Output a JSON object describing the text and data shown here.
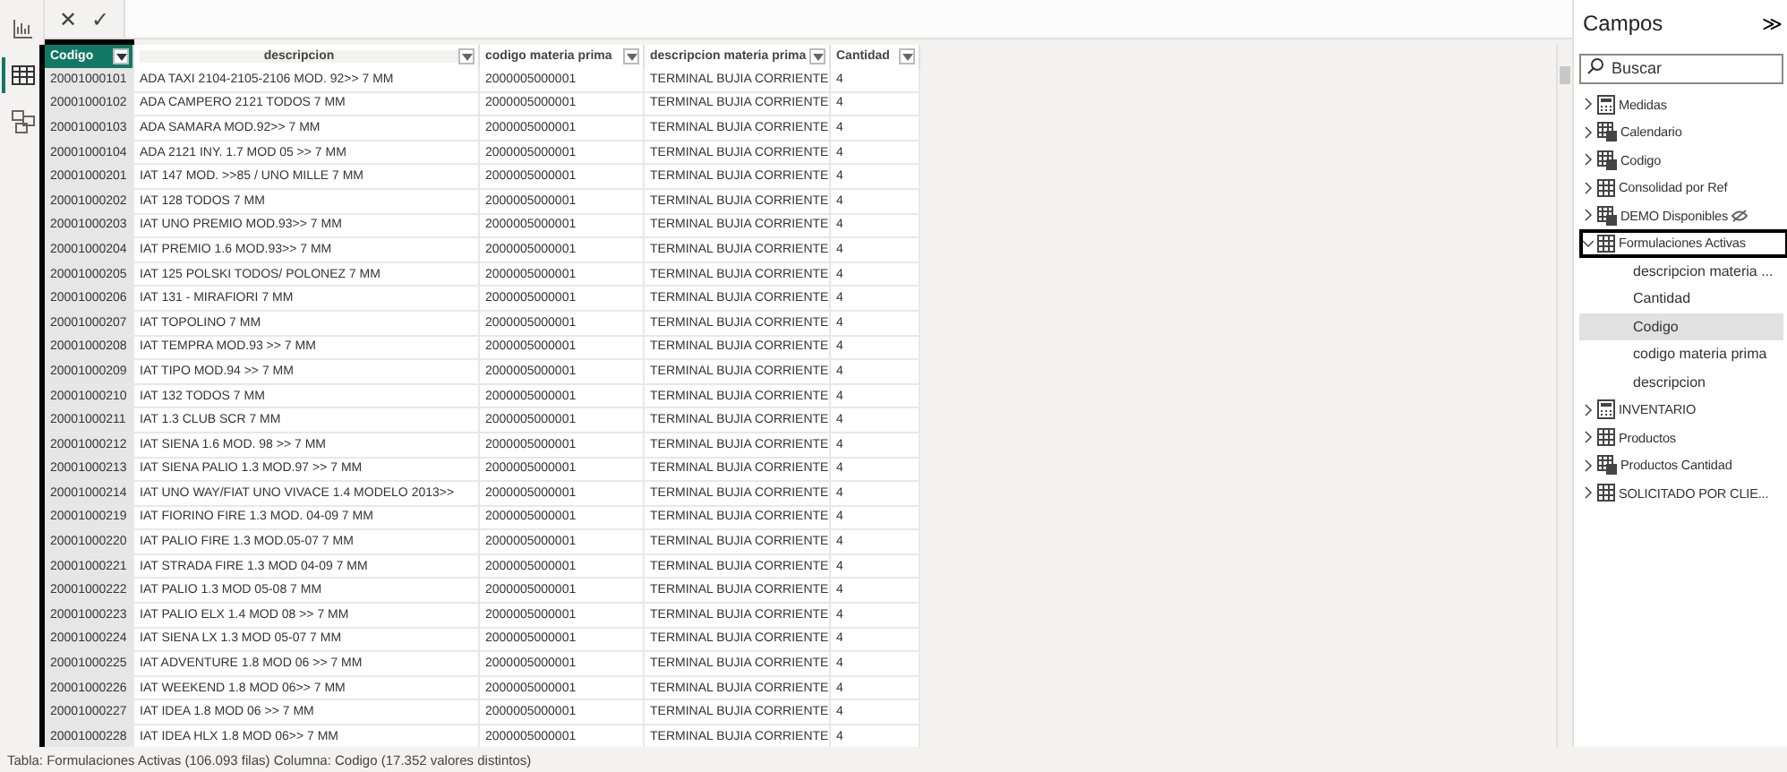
{
  "view_rail": [
    {
      "kind": "report",
      "selected": false
    },
    {
      "kind": "data",
      "selected": true
    },
    {
      "kind": "model",
      "selected": false
    }
  ],
  "formula_bar": {
    "cancel": "✕",
    "commit": "✓"
  },
  "table": {
    "columns": [
      {
        "label": "Codigo",
        "selected": true,
        "highlighted": true
      },
      {
        "label": "descripcion",
        "selected": false,
        "highlighted": false
      },
      {
        "label": "codigo materia prima",
        "selected": false,
        "highlighted": false
      },
      {
        "label": "descripcion materia prima",
        "selected": false,
        "highlighted": false
      },
      {
        "label": "Cantidad",
        "selected": false,
        "highlighted": false
      }
    ],
    "rows": [
      [
        "20001000101",
        "ADA TAXI  2104-2105-2106 MOD. 92>> 7 MM",
        "2000005000001",
        "TERMINAL BUJIA CORRIENTE",
        "4"
      ],
      [
        "20001000102",
        "ADA CAMPERO 2121 TODOS 7 MM",
        "2000005000001",
        "TERMINAL BUJIA CORRIENTE",
        "4"
      ],
      [
        "20001000103",
        "ADA SAMARA MOD.92>> 7 MM",
        "2000005000001",
        "TERMINAL BUJIA CORRIENTE",
        "4"
      ],
      [
        "20001000104",
        "ADA 2121 INY. 1.7 MOD 05 >> 7 MM",
        "2000005000001",
        "TERMINAL BUJIA CORRIENTE",
        "4"
      ],
      [
        "20001000201",
        "IAT 147 MOD. >>85 / UNO MILLE 7 MM",
        "2000005000001",
        "TERMINAL BUJIA CORRIENTE",
        "4"
      ],
      [
        "20001000202",
        "IAT 128 TODOS 7 MM",
        "2000005000001",
        "TERMINAL BUJIA CORRIENTE",
        "4"
      ],
      [
        "20001000203",
        "IAT UNO PREMIO MOD.93>> 7 MM",
        "2000005000001",
        "TERMINAL BUJIA CORRIENTE",
        "4"
      ],
      [
        "20001000204",
        "IAT PREMIO 1.6 MOD.93>> 7 MM",
        "2000005000001",
        "TERMINAL BUJIA CORRIENTE",
        "4"
      ],
      [
        "20001000205",
        "IAT 125 POLSKI TODOS/ POLONEZ 7 MM",
        "2000005000001",
        "TERMINAL BUJIA CORRIENTE",
        "4"
      ],
      [
        "20001000206",
        "IAT 131 - MIRAFIORI 7 MM",
        "2000005000001",
        "TERMINAL BUJIA CORRIENTE",
        "4"
      ],
      [
        "20001000207",
        "IAT TOPOLINO 7 MM",
        "2000005000001",
        "TERMINAL BUJIA CORRIENTE",
        "4"
      ],
      [
        "20001000208",
        "IAT TEMPRA MOD.93 >> 7 MM",
        "2000005000001",
        "TERMINAL BUJIA CORRIENTE",
        "4"
      ],
      [
        "20001000209",
        "IAT TIPO MOD.94 >> 7 MM",
        "2000005000001",
        "TERMINAL BUJIA CORRIENTE",
        "4"
      ],
      [
        "20001000210",
        "IAT 132 TODOS 7 MM",
        "2000005000001",
        "TERMINAL BUJIA CORRIENTE",
        "4"
      ],
      [
        "20001000211",
        "IAT 1.3 CLUB SCR 7 MM",
        "2000005000001",
        "TERMINAL BUJIA CORRIENTE",
        "4"
      ],
      [
        "20001000212",
        "IAT SIENA 1.6 MOD. 98 >> 7 MM",
        "2000005000001",
        "TERMINAL BUJIA CORRIENTE",
        "4"
      ],
      [
        "20001000213",
        "IAT SIENA PALIO 1.3 MOD.97 >> 7 MM",
        "2000005000001",
        "TERMINAL BUJIA CORRIENTE",
        "4"
      ],
      [
        "20001000214",
        "IAT UNO WAY/FIAT UNO VIVACE 1.4 MODELO 2013>>",
        "2000005000001",
        "TERMINAL BUJIA CORRIENTE",
        "4"
      ],
      [
        "20001000219",
        "IAT FIORINO FIRE 1.3 MOD. 04-09 7 MM",
        "2000005000001",
        "TERMINAL BUJIA CORRIENTE",
        "4"
      ],
      [
        "20001000220",
        "IAT PALIO FIRE 1.3 MOD.05-07 7 MM",
        "2000005000001",
        "TERMINAL BUJIA CORRIENTE",
        "4"
      ],
      [
        "20001000221",
        "IAT STRADA FIRE 1.3 MOD 04-09 7 MM",
        "2000005000001",
        "TERMINAL BUJIA CORRIENTE",
        "4"
      ],
      [
        "20001000222",
        "IAT PALIO 1.3 MOD 05-08 7 MM",
        "2000005000001",
        "TERMINAL BUJIA CORRIENTE",
        "4"
      ],
      [
        "20001000223",
        "IAT PALIO ELX 1.4 MOD 08 >> 7 MM",
        "2000005000001",
        "TERMINAL BUJIA CORRIENTE",
        "4"
      ],
      [
        "20001000224",
        "IAT SIENA LX 1.3 MOD 05-07 7 MM",
        "2000005000001",
        "TERMINAL BUJIA CORRIENTE",
        "4"
      ],
      [
        "20001000225",
        "IAT ADVENTURE 1.8 MOD 06 >> 7 MM",
        "2000005000001",
        "TERMINAL BUJIA CORRIENTE",
        "4"
      ],
      [
        "20001000226",
        "IAT WEEKEND 1.8 MOD 06>> 7 MM",
        "2000005000001",
        "TERMINAL BUJIA CORRIENTE",
        "4"
      ],
      [
        "20001000227",
        "IAT IDEA 1.8 MOD 06 >> 7 MM",
        "2000005000001",
        "TERMINAL BUJIA CORRIENTE",
        "4"
      ],
      [
        "20001000228",
        "IAT IDEA HLX 1.8 MOD 06>> 7 MM",
        "2000005000001",
        "TERMINAL BUJIA CORRIENTE",
        "4"
      ]
    ]
  },
  "status_bar": "Tabla: Formulaciones Activas (106.093 filas) Columna: Codigo (17.352 valores distintos)",
  "fields_pane": {
    "title": "Campos",
    "collapse": "≫",
    "search": {
      "placeholder": "Buscar"
    },
    "tables": [
      {
        "name": "Medidas",
        "kind": "measures",
        "expanded": false,
        "hidden": false,
        "highlighted": false
      },
      {
        "name": "Calendario",
        "kind": "calculated",
        "expanded": false,
        "hidden": false,
        "highlighted": false
      },
      {
        "name": "Codigo",
        "kind": "calculated",
        "expanded": false,
        "hidden": false,
        "highlighted": false
      },
      {
        "name": "Consolidad por Ref",
        "kind": "table",
        "expanded": false,
        "hidden": false,
        "highlighted": false
      },
      {
        "name": "DEMO Disponibles",
        "kind": "calculated",
        "expanded": false,
        "hidden": true,
        "highlighted": false
      },
      {
        "name": "Formulaciones Activas",
        "kind": "table",
        "expanded": true,
        "hidden": false,
        "highlighted": true,
        "children": [
          {
            "name": "descripcion materia ...",
            "selected": false
          },
          {
            "name": "Cantidad",
            "selected": false
          },
          {
            "name": "Codigo",
            "selected": true
          },
          {
            "name": "codigo materia prima",
            "selected": false
          },
          {
            "name": "descripcion",
            "selected": false
          }
        ]
      },
      {
        "name": "INVENTARIO",
        "kind": "measures",
        "expanded": false,
        "hidden": false,
        "highlighted": false
      },
      {
        "name": "Productos",
        "kind": "table",
        "expanded": false,
        "hidden": false,
        "highlighted": false
      },
      {
        "name": "Productos Cantidad",
        "kind": "calculated",
        "expanded": false,
        "hidden": false,
        "highlighted": false
      },
      {
        "name": "SOLICITADO POR CLIE...",
        "kind": "table",
        "expanded": false,
        "hidden": false,
        "highlighted": false
      }
    ]
  }
}
